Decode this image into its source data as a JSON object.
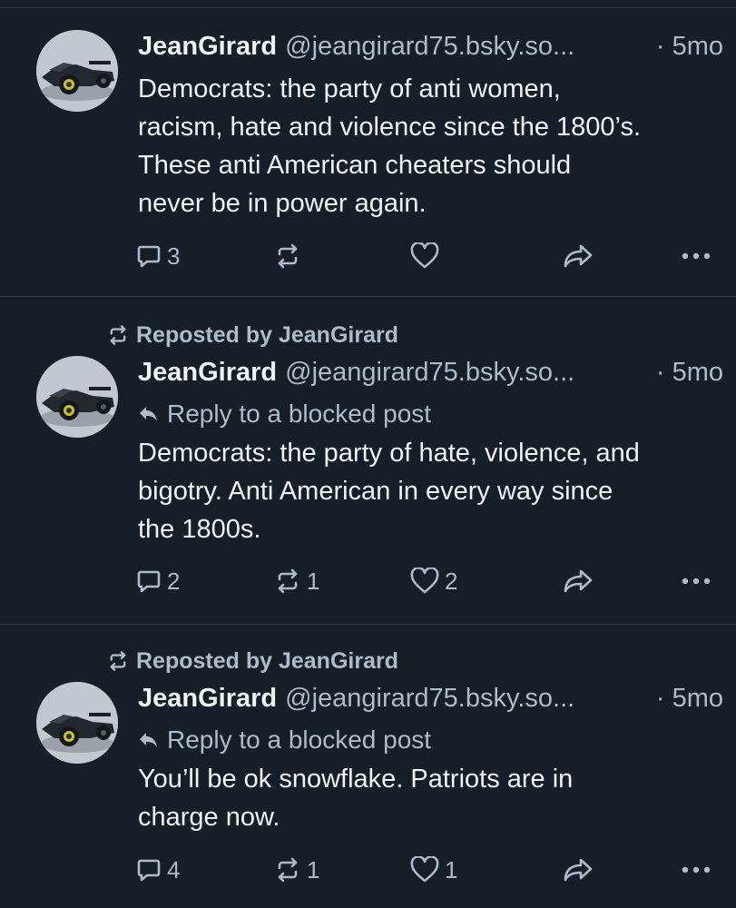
{
  "posts": [
    {
      "author": "JeanGirard",
      "handle": "@jeangirard75.bsky.so...",
      "separator": "·",
      "time": "5mo",
      "text": "Democrats: the party of anti women,\nracism, hate and violence since the 1800’s.\nThese anti American cheaters should\nnever be in power again.",
      "replies": "3",
      "reposts": "",
      "likes": ""
    },
    {
      "repost_label": "Reposted by JeanGirard",
      "author": "JeanGirard",
      "handle": "@jeangirard75.bsky.so...",
      "separator": "·",
      "time": "5mo",
      "reply_label": "Reply to a blocked post",
      "text": "Democrats: the party of hate, violence, and\nbigotry. Anti American in every way since\nthe 1800s.",
      "replies": "2",
      "reposts": "1",
      "likes": "2"
    },
    {
      "repost_label": "Reposted by JeanGirard",
      "author": "JeanGirard",
      "handle": "@jeangirard75.bsky.so...",
      "separator": "·",
      "time": "5mo",
      "reply_label": "Reply to a blocked post",
      "text": "You’ll be ok snowflake. Patriots are in\ncharge now.",
      "replies": "4",
      "reposts": "1",
      "likes": "1"
    }
  ],
  "icons": {
    "reply": "speech-bubble-icon",
    "repost": "repost-arrows-icon",
    "like": "heart-icon",
    "share": "share-arrow-icon",
    "more": "more-dots-icon",
    "reply_to": "reply-arrow-icon",
    "avatar_image": "race-car-avatar"
  },
  "colors": {
    "background": "#161e27",
    "divider": "#2e3a47",
    "primary_text": "#f1f3f5",
    "secondary_text": "#aebbc9"
  }
}
